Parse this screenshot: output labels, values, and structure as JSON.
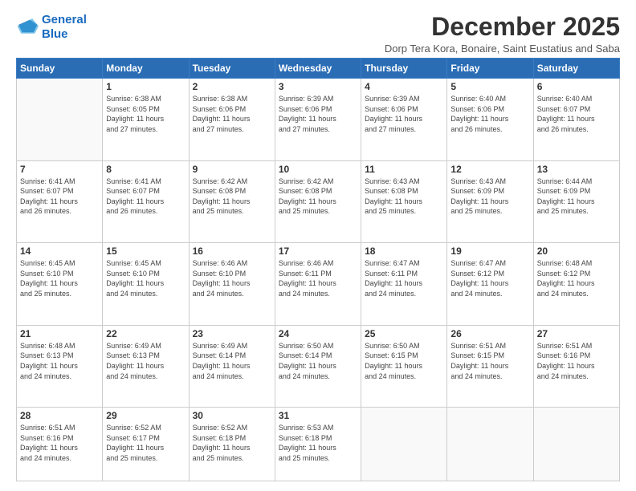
{
  "logo": {
    "line1": "General",
    "line2": "Blue"
  },
  "header": {
    "title": "December 2025",
    "subtitle": "Dorp Tera Kora, Bonaire, Saint Eustatius and Saba"
  },
  "weekdays": [
    "Sunday",
    "Monday",
    "Tuesday",
    "Wednesday",
    "Thursday",
    "Friday",
    "Saturday"
  ],
  "days": [
    {
      "num": "",
      "empty": true
    },
    {
      "num": "1",
      "rise": "6:38 AM",
      "set": "6:05 PM",
      "daylight": "11 hours and 27 minutes."
    },
    {
      "num": "2",
      "rise": "6:38 AM",
      "set": "6:06 PM",
      "daylight": "11 hours and 27 minutes."
    },
    {
      "num": "3",
      "rise": "6:39 AM",
      "set": "6:06 PM",
      "daylight": "11 hours and 27 minutes."
    },
    {
      "num": "4",
      "rise": "6:39 AM",
      "set": "6:06 PM",
      "daylight": "11 hours and 27 minutes."
    },
    {
      "num": "5",
      "rise": "6:40 AM",
      "set": "6:06 PM",
      "daylight": "11 hours and 26 minutes."
    },
    {
      "num": "6",
      "rise": "6:40 AM",
      "set": "6:07 PM",
      "daylight": "11 hours and 26 minutes."
    },
    {
      "num": "7",
      "rise": "6:41 AM",
      "set": "6:07 PM",
      "daylight": "11 hours and 26 minutes."
    },
    {
      "num": "8",
      "rise": "6:41 AM",
      "set": "6:07 PM",
      "daylight": "11 hours and 26 minutes."
    },
    {
      "num": "9",
      "rise": "6:42 AM",
      "set": "6:08 PM",
      "daylight": "11 hours and 25 minutes."
    },
    {
      "num": "10",
      "rise": "6:42 AM",
      "set": "6:08 PM",
      "daylight": "11 hours and 25 minutes."
    },
    {
      "num": "11",
      "rise": "6:43 AM",
      "set": "6:08 PM",
      "daylight": "11 hours and 25 minutes."
    },
    {
      "num": "12",
      "rise": "6:43 AM",
      "set": "6:09 PM",
      "daylight": "11 hours and 25 minutes."
    },
    {
      "num": "13",
      "rise": "6:44 AM",
      "set": "6:09 PM",
      "daylight": "11 hours and 25 minutes."
    },
    {
      "num": "14",
      "rise": "6:45 AM",
      "set": "6:10 PM",
      "daylight": "11 hours and 25 minutes."
    },
    {
      "num": "15",
      "rise": "6:45 AM",
      "set": "6:10 PM",
      "daylight": "11 hours and 24 minutes."
    },
    {
      "num": "16",
      "rise": "6:46 AM",
      "set": "6:10 PM",
      "daylight": "11 hours and 24 minutes."
    },
    {
      "num": "17",
      "rise": "6:46 AM",
      "set": "6:11 PM",
      "daylight": "11 hours and 24 minutes."
    },
    {
      "num": "18",
      "rise": "6:47 AM",
      "set": "6:11 PM",
      "daylight": "11 hours and 24 minutes."
    },
    {
      "num": "19",
      "rise": "6:47 AM",
      "set": "6:12 PM",
      "daylight": "11 hours and 24 minutes."
    },
    {
      "num": "20",
      "rise": "6:48 AM",
      "set": "6:12 PM",
      "daylight": "11 hours and 24 minutes."
    },
    {
      "num": "21",
      "rise": "6:48 AM",
      "set": "6:13 PM",
      "daylight": "11 hours and 24 minutes."
    },
    {
      "num": "22",
      "rise": "6:49 AM",
      "set": "6:13 PM",
      "daylight": "11 hours and 24 minutes."
    },
    {
      "num": "23",
      "rise": "6:49 AM",
      "set": "6:14 PM",
      "daylight": "11 hours and 24 minutes."
    },
    {
      "num": "24",
      "rise": "6:50 AM",
      "set": "6:14 PM",
      "daylight": "11 hours and 24 minutes."
    },
    {
      "num": "25",
      "rise": "6:50 AM",
      "set": "6:15 PM",
      "daylight": "11 hours and 24 minutes."
    },
    {
      "num": "26",
      "rise": "6:51 AM",
      "set": "6:15 PM",
      "daylight": "11 hours and 24 minutes."
    },
    {
      "num": "27",
      "rise": "6:51 AM",
      "set": "6:16 PM",
      "daylight": "11 hours and 24 minutes."
    },
    {
      "num": "28",
      "rise": "6:51 AM",
      "set": "6:16 PM",
      "daylight": "11 hours and 24 minutes."
    },
    {
      "num": "29",
      "rise": "6:52 AM",
      "set": "6:17 PM",
      "daylight": "11 hours and 25 minutes."
    },
    {
      "num": "30",
      "rise": "6:52 AM",
      "set": "6:18 PM",
      "daylight": "11 hours and 25 minutes."
    },
    {
      "num": "31",
      "rise": "6:53 AM",
      "set": "6:18 PM",
      "daylight": "11 hours and 25 minutes."
    }
  ],
  "labels": {
    "sunrise": "Sunrise:",
    "sunset": "Sunset:",
    "daylight": "Daylight:"
  }
}
